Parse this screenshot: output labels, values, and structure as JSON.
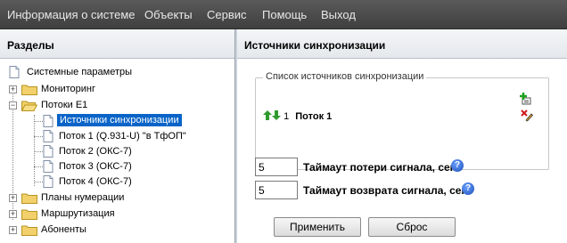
{
  "menu": {
    "items": [
      {
        "label": "Информация о системе"
      },
      {
        "label": "Объекты"
      },
      {
        "label": "Сервис"
      },
      {
        "label": "Помощь"
      },
      {
        "label": "Выход"
      }
    ]
  },
  "left_panel": {
    "title": "Разделы",
    "tree": [
      {
        "label": "Системные параметры",
        "icon": "document-icon",
        "expander": ""
      },
      {
        "label": "Мониторинг",
        "icon": "folder-icon",
        "expander": "+"
      },
      {
        "label": "Потоки Е1",
        "icon": "folder-icon",
        "expander": "−"
      },
      {
        "label": "Источники синхронизации",
        "icon": "document-icon",
        "selected": true
      },
      {
        "label": "Поток 1 (Q.931-U) \"в ТфОП\"",
        "icon": "document-icon"
      },
      {
        "label": "Поток 2 (ОКС-7)",
        "icon": "document-icon"
      },
      {
        "label": "Поток 3 (ОКС-7)",
        "icon": "document-icon"
      },
      {
        "label": "Поток 4 (ОКС-7)",
        "icon": "document-icon"
      },
      {
        "label": "Планы нумерации",
        "icon": "folder-icon",
        "expander": "+"
      },
      {
        "label": "Маршрутизация",
        "icon": "folder-icon",
        "expander": "+"
      },
      {
        "label": "Абоненты",
        "icon": "folder-icon",
        "expander": "+"
      }
    ]
  },
  "right_panel": {
    "title": "Источники синхронизации",
    "sources": {
      "legend": "Список источников синхронизации",
      "row": {
        "priority": "1",
        "name": "Поток 1"
      }
    },
    "loss_timeout": {
      "value": "5",
      "label": "Таймаут потери сигнала, сек"
    },
    "return_timeout": {
      "value": "5",
      "label": "Таймаут возврата сигнала, сек"
    },
    "apply_label": "Применить",
    "reset_label": "Сброс"
  },
  "colors": {
    "menubar": "#4a4a4a",
    "selection": "#0a64c8",
    "arrow_green": "#2e9a2e",
    "help_blue": "#1f4fb8"
  }
}
